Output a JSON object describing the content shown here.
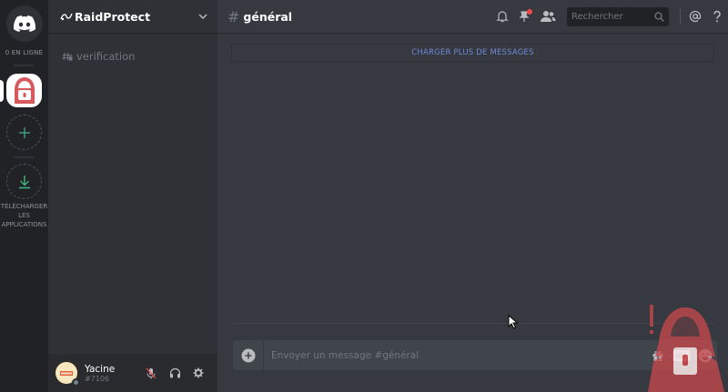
{
  "rail": {
    "online_label": "0 EN LIGNE",
    "download_label_lines": [
      "TÉLÉCHARGER",
      "LES",
      "APPLICATIONS"
    ],
    "icons": [
      "discord-logo-icon",
      "add-server-icon",
      "download-icon"
    ]
  },
  "server": {
    "name": "RaidProtect",
    "channels": [
      {
        "name": "verification",
        "icon": "locked-hash-icon"
      }
    ]
  },
  "user": {
    "name": "Yacine",
    "tag": "#7106",
    "status": "offline"
  },
  "channel": {
    "hash": "#",
    "name": "général"
  },
  "toolbar": {
    "search_placeholder": "Rechercher",
    "icons": [
      "bell-icon",
      "pin-icon",
      "members-icon",
      "search-icon",
      "mention-icon",
      "help-icon"
    ]
  },
  "messages": {
    "load_more_label": "CHARGER PLUS DE MESSAGES"
  },
  "composer": {
    "placeholder": "Envoyer un message #général",
    "icons": [
      "add-file-icon",
      "gift-icon",
      "gif-icon",
      "emoji-icon"
    ]
  },
  "colors": {
    "rail_bg": "#202225",
    "sidebar_bg": "#2f3136",
    "main_bg": "#36393f",
    "accent": "#7289da",
    "server_icon": "#d8595c",
    "mention_badge": "#f04747"
  }
}
